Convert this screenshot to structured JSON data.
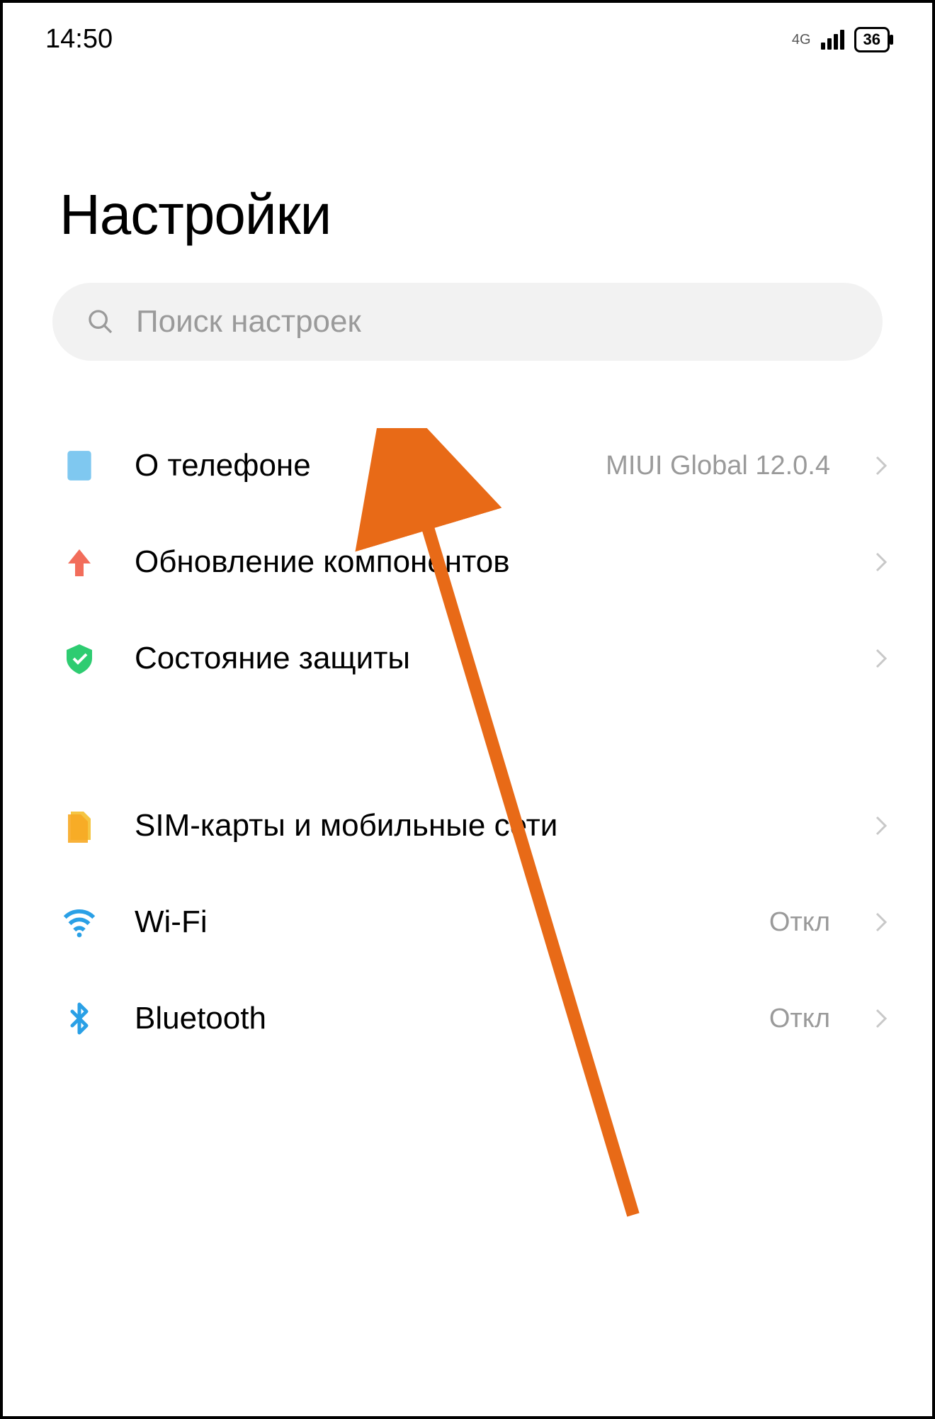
{
  "status": {
    "time": "14:50",
    "network": "4G",
    "battery": "36"
  },
  "title": "Настройки",
  "search": {
    "placeholder": "Поиск настроек"
  },
  "items": [
    {
      "label": "О телефоне",
      "value": "MIUI Global 12.0.4"
    },
    {
      "label": "Обновление компонентов",
      "value": ""
    },
    {
      "label": "Состояние защиты",
      "value": ""
    },
    {
      "label": "SIM-карты и мобильные сети",
      "value": ""
    },
    {
      "label": "Wi-Fi",
      "value": "Откл"
    },
    {
      "label": "Bluetooth",
      "value": "Откл"
    }
  ]
}
